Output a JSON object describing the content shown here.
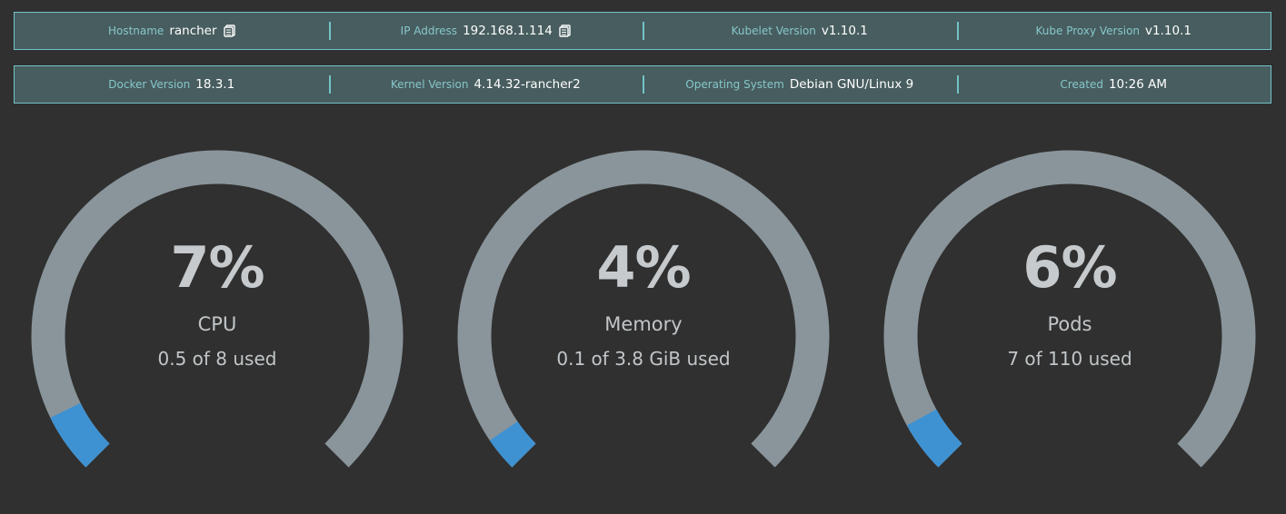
{
  "info_row_1": [
    {
      "label": "Hostname",
      "value": "rancher",
      "copy": true
    },
    {
      "label": "IP Address",
      "value": "192.168.1.114",
      "copy": true
    },
    {
      "label": "Kubelet Version",
      "value": "v1.10.1",
      "copy": false
    },
    {
      "label": "Kube Proxy Version",
      "value": "v1.10.1",
      "copy": false
    }
  ],
  "info_row_2": [
    {
      "label": "Docker Version",
      "value": "18.3.1"
    },
    {
      "label": "Kernel Version",
      "value": "4.14.32-rancher2"
    },
    {
      "label": "Operating System",
      "value": "Debian GNU/Linux 9"
    },
    {
      "label": "Created",
      "value": "10:26 AM"
    }
  ],
  "gauges": [
    {
      "percent_label": "7%",
      "percent": 7,
      "title": "CPU",
      "usage": "0.5 of 8 used"
    },
    {
      "percent_label": "4%",
      "percent": 4,
      "title": "Memory",
      "usage": "0.1 of 3.8 GiB used"
    },
    {
      "percent_label": "6%",
      "percent": 6,
      "title": "Pods",
      "usage": "7 of 110 used"
    }
  ],
  "colors": {
    "background": "#303030",
    "bar_fill": "#485d5f",
    "bar_border": "#73c3c8",
    "gauge_track": "#8a959b",
    "gauge_fill": "#3f92d2"
  },
  "icons": {
    "copy": "clipboard-icon"
  }
}
